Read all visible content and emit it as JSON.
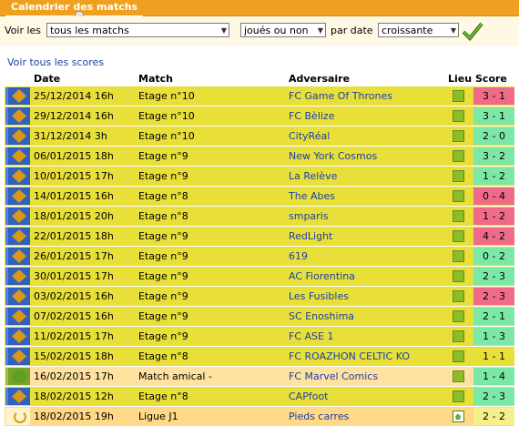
{
  "header": {
    "title": "Calendrier des matchs"
  },
  "filters": {
    "voir_label": "Voir les",
    "type_select": "tous les matchs",
    "played_select": "joués ou non",
    "par_date_label": "par date",
    "order_select": "croissante"
  },
  "links": {
    "all_scores": "Voir tous les scores"
  },
  "table": {
    "headers": {
      "date": "Date",
      "match": "Match",
      "adversaire": "Adversaire",
      "lieu": "Lieu",
      "score": "Score"
    },
    "rows": [
      {
        "date": "25/12/2014 16h",
        "match": "Etage n°10",
        "opponent": "FC Game Of Thrones",
        "score": "3 - 1",
        "result": "loss",
        "type": "championnat",
        "lieu": "away"
      },
      {
        "date": "29/12/2014 16h",
        "match": "Etage n°10",
        "opponent": "FC Bèlize",
        "score": "3 - 1",
        "result": "win",
        "type": "championnat",
        "lieu": "away"
      },
      {
        "date": "31/12/2014 3h",
        "match": "Etage n°10",
        "opponent": "CityRéal",
        "score": "2 - 0",
        "result": "win",
        "type": "championnat",
        "lieu": "away"
      },
      {
        "date": "06/01/2015 18h",
        "match": "Etage n°9",
        "opponent": "New York Cosmos",
        "score": "3 - 2",
        "result": "win",
        "type": "championnat",
        "lieu": "away"
      },
      {
        "date": "10/01/2015 17h",
        "match": "Etage n°9",
        "opponent": "La Relève",
        "score": "1 - 2",
        "result": "win",
        "type": "championnat",
        "lieu": "away"
      },
      {
        "date": "14/01/2015 16h",
        "match": "Etage n°8",
        "opponent": "The Abes",
        "score": "0 - 4",
        "result": "loss",
        "type": "championnat",
        "lieu": "away"
      },
      {
        "date": "18/01/2015 20h",
        "match": "Etage n°8",
        "opponent": "smparis",
        "score": "1 - 2",
        "result": "loss",
        "type": "championnat",
        "lieu": "away"
      },
      {
        "date": "22/01/2015 18h",
        "match": "Etage n°9",
        "opponent": "RedLight",
        "score": "4 - 2",
        "result": "loss",
        "type": "championnat",
        "lieu": "away"
      },
      {
        "date": "26/01/2015 17h",
        "match": "Etage n°9",
        "opponent": "619",
        "score": "0 - 2",
        "result": "win",
        "type": "championnat",
        "lieu": "away"
      },
      {
        "date": "30/01/2015 17h",
        "match": "Etage n°9",
        "opponent": "AC Fiorentina",
        "score": "2 - 3",
        "result": "win",
        "type": "championnat",
        "lieu": "away"
      },
      {
        "date": "03/02/2015 16h",
        "match": "Etage n°9",
        "opponent": "Les Fusibles",
        "score": "2 - 3",
        "result": "loss",
        "type": "championnat",
        "lieu": "away"
      },
      {
        "date": "07/02/2015 16h",
        "match": "Etage n°9",
        "opponent": "SC Enoshima",
        "score": "2 - 1",
        "result": "win",
        "type": "championnat",
        "lieu": "away"
      },
      {
        "date": "11/02/2015 17h",
        "match": "Etage n°9",
        "opponent": "FC ASE 1",
        "score": "1 - 3",
        "result": "win",
        "type": "championnat",
        "lieu": "away"
      },
      {
        "date": "15/02/2015 18h",
        "match": "Etage n°8",
        "opponent": "FC ROAZHON CELTIC KO",
        "score": "1 - 1",
        "result": "draw",
        "type": "championnat",
        "lieu": "away"
      },
      {
        "date": "16/02/2015 17h",
        "match": "Match amical -",
        "opponent": "FC Marvel Comics",
        "score": "1 - 4",
        "result": "win",
        "type": "amical",
        "lieu": "away"
      },
      {
        "date": "18/02/2015 12h",
        "match": "Etage n°8",
        "opponent": "CAPfoot",
        "score": "2 - 3",
        "result": "win",
        "type": "championnat",
        "lieu": "away"
      },
      {
        "date": "18/02/2015 19h",
        "match": "Ligue J1",
        "opponent": "Pieds carres",
        "score": "2 - 2",
        "result": "pending",
        "type": "ligue",
        "lieu": "home"
      }
    ]
  },
  "colors": {
    "header_bar": "#f0a020",
    "row": "#e8e038",
    "win": "#7ce8a8",
    "loss": "#f06a8a",
    "link": "#1a3fa8"
  }
}
